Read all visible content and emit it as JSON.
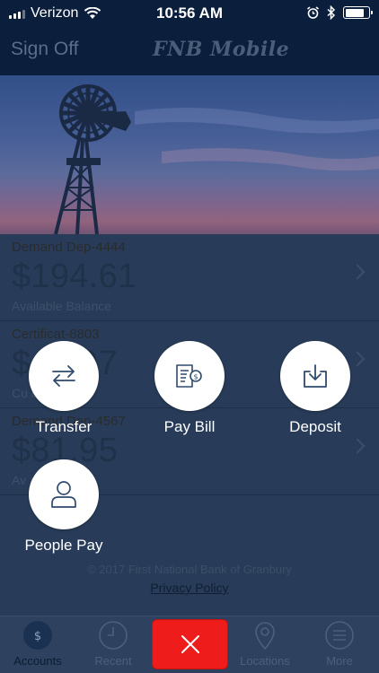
{
  "status_bar": {
    "carrier": "Verizon",
    "time": "10:56 AM"
  },
  "header": {
    "signoff_label": "Sign Off",
    "app_title": "FNB Mobile"
  },
  "accounts": [
    {
      "name": "Demand Dep-4444",
      "amount": "$194.61",
      "sub_label": "Available Balance"
    },
    {
      "name": "Certificat-8803",
      "amount": "$  7297",
      "sub_label": "Cu          ce"
    },
    {
      "name": "Demand Dep-4567",
      "amount": "$81.95",
      "sub_label": "Av          ance"
    }
  ],
  "footer": {
    "copyright": "© 2017 First National Bank of Granbury",
    "privacy_link": "Privacy Policy"
  },
  "actions": {
    "transfer": "Transfer",
    "pay_bill": "Pay Bill",
    "deposit": "Deposit",
    "people_pay": "People Pay"
  },
  "tabs": {
    "accounts": "Accounts",
    "recent": "Recent",
    "locations": "Locations",
    "more": "More"
  },
  "colors": {
    "overlay_navy": "#283c59",
    "header_navy": "#0b1f3d",
    "close_red": "#ef1c1c"
  },
  "icons": {
    "transfer": "swap-arrows-icon",
    "pay_bill": "bill-icon",
    "deposit": "tray-download-icon",
    "people_pay": "person-icon",
    "close": "close-x-icon"
  }
}
